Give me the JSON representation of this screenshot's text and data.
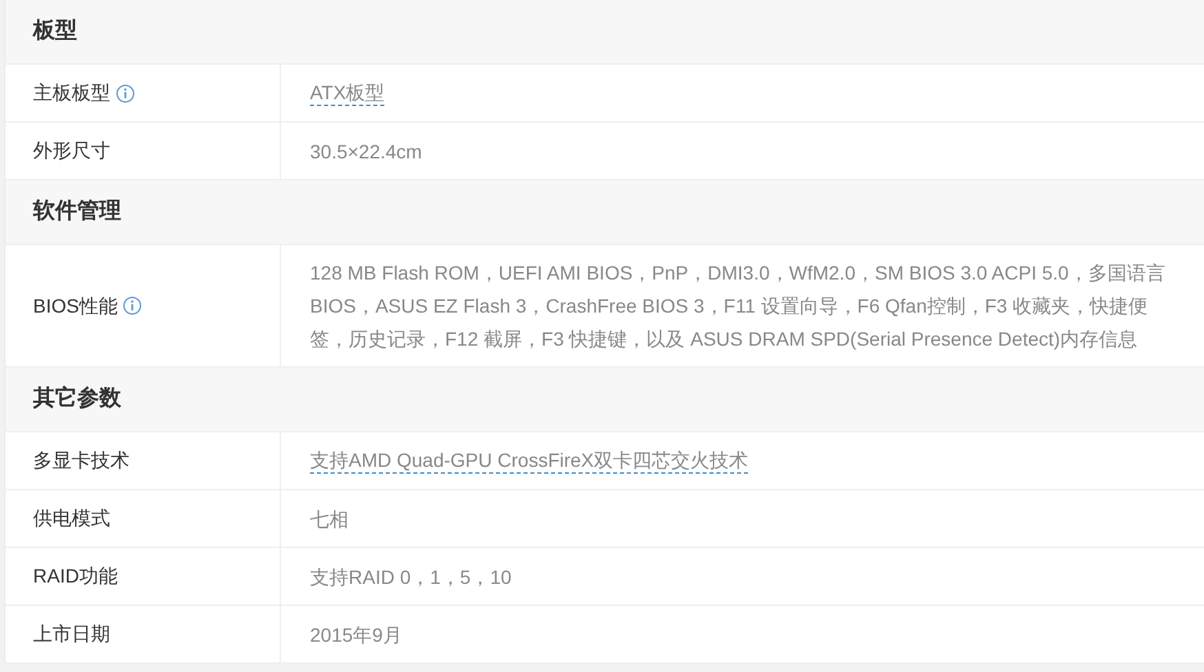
{
  "sections": [
    {
      "title": "板型",
      "rows": [
        {
          "label": "主板板型",
          "info": true,
          "value": "ATX板型",
          "kind": "link"
        },
        {
          "label": "外形尺寸",
          "info": false,
          "value": "30.5×22.4cm",
          "kind": "text"
        }
      ]
    },
    {
      "title": "软件管理",
      "rows": [
        {
          "label": "BIOS性能",
          "info": true,
          "value": "128 MB Flash ROM，UEFI AMI BIOS，PnP，DMI3.0，WfM2.0，SM BIOS 3.0 ACPI 5.0，多国语言 BIOS，ASUS EZ Flash 3，CrashFree BIOS 3，F11 设置向导，F6 Qfan控制，F3 收藏夹，快捷便签，历史记录，F12 截屏，F3 快捷键，以及 ASUS DRAM SPD(Serial Presence Detect)内存信息",
          "kind": "text"
        }
      ]
    },
    {
      "title": "其它参数",
      "rows": [
        {
          "label": "多显卡技术",
          "info": false,
          "value": "支持AMD Quad-GPU CrossFireX双卡四芯交火技术",
          "kind": "link"
        },
        {
          "label": "供电模式",
          "info": false,
          "value": "七相",
          "kind": "text"
        },
        {
          "label": "RAID功能",
          "info": false,
          "value": "支持RAID 0，1，5，10",
          "kind": "text"
        },
        {
          "label": "上市日期",
          "info": false,
          "value": "2015年9月",
          "kind": "text"
        }
      ]
    }
  ]
}
